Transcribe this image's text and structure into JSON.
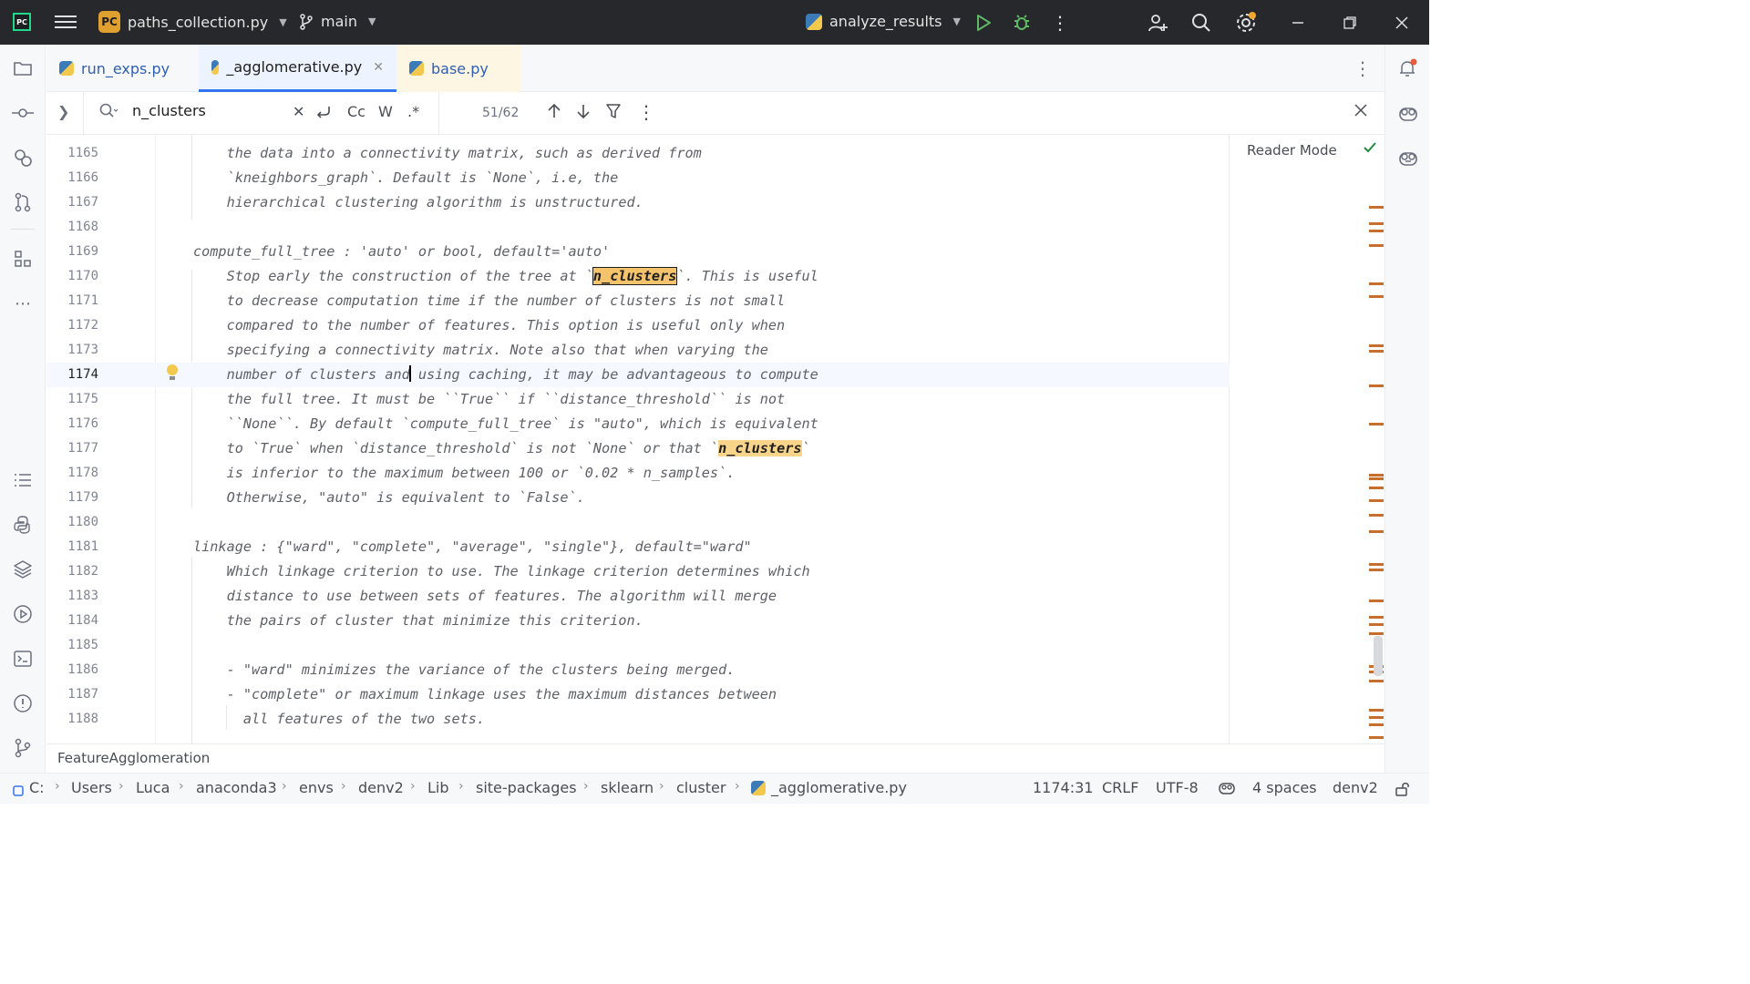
{
  "titlebar": {
    "logo": "PC",
    "project_badge": "PC",
    "project_file": "paths_collection.py",
    "branch": "main",
    "run_config": "analyze_results"
  },
  "tabs": [
    {
      "label": "run_exps.py",
      "active": false
    },
    {
      "label": "_agglomerative.py",
      "active": true
    },
    {
      "label": "base.py",
      "active": false
    }
  ],
  "find": {
    "query": "n_clusters",
    "match_case_label": "Cc",
    "words_label": "W",
    "regex_label": ".*",
    "count": "51/62"
  },
  "editor": {
    "reader_mode_label": "Reader Mode",
    "current_line": 1174,
    "lines": [
      {
        "num": "1165",
        "text": "    the data into a connectivity matrix, such as derived from"
      },
      {
        "num": "1166",
        "text": "    `kneighbors_graph`. Default is `None`, i.e, the"
      },
      {
        "num": "1167",
        "text": "    hierarchical clustering algorithm is unstructured."
      },
      {
        "num": "1168",
        "text": ""
      },
      {
        "num": "1169",
        "text": "compute_full_tree : 'auto' or bool, default='auto'"
      },
      {
        "num": "1170",
        "text": "    Stop early the construction of the tree at `n_clusters`. This is useful"
      },
      {
        "num": "1171",
        "text": "    to decrease computation time if the number of clusters is not small"
      },
      {
        "num": "1172",
        "text": "    compared to the number of features. This option is useful only when"
      },
      {
        "num": "1173",
        "text": "    specifying a connectivity matrix. Note also that when varying the"
      },
      {
        "num": "1174",
        "text": "    number of clusters and using caching, it may be advantageous to compute"
      },
      {
        "num": "1175",
        "text": "    the full tree. It must be ``True`` if ``distance_threshold`` is not"
      },
      {
        "num": "1176",
        "text": "    ``None``. By default `compute_full_tree` is \"auto\", which is equivalent"
      },
      {
        "num": "1177",
        "text": "    to `True` when `distance_threshold` is not `None` or that `n_clusters`"
      },
      {
        "num": "1178",
        "text": "    is inferior to the maximum between 100 or `0.02 * n_samples`."
      },
      {
        "num": "1179",
        "text": "    Otherwise, \"auto\" is equivalent to `False`."
      },
      {
        "num": "1180",
        "text": ""
      },
      {
        "num": "1181",
        "text": "linkage : {\"ward\", \"complete\", \"average\", \"single\"}, default=\"ward\""
      },
      {
        "num": "1182",
        "text": "    Which linkage criterion to use. The linkage criterion determines which"
      },
      {
        "num": "1183",
        "text": "    distance to use between sets of features. The algorithm will merge"
      },
      {
        "num": "1184",
        "text": "    the pairs of cluster that minimize this criterion."
      },
      {
        "num": "1185",
        "text": ""
      },
      {
        "num": "1186",
        "text": "    - \"ward\" minimizes the variance of the clusters being merged."
      },
      {
        "num": "1187",
        "text": "    - \"complete\" or maximum linkage uses the maximum distances between"
      },
      {
        "num": "1188",
        "text": "      all features of the two sets."
      }
    ]
  },
  "breadcrumb": "FeatureAgglomeration",
  "path": [
    "C:",
    "Users",
    "Luca",
    "anaconda3",
    "envs",
    "denv2",
    "Lib",
    "site-packages",
    "sklearn",
    "cluster",
    "_agglomerative.py"
  ],
  "status": {
    "position": "1174:31",
    "line_sep": "CRLF",
    "encoding": "UTF-8",
    "indent": "4 spaces",
    "interpreter": "denv2"
  },
  "colors": {
    "accent": "#3574f0",
    "match_highlight": "#f9d58b",
    "marker": "#c86e2c"
  }
}
